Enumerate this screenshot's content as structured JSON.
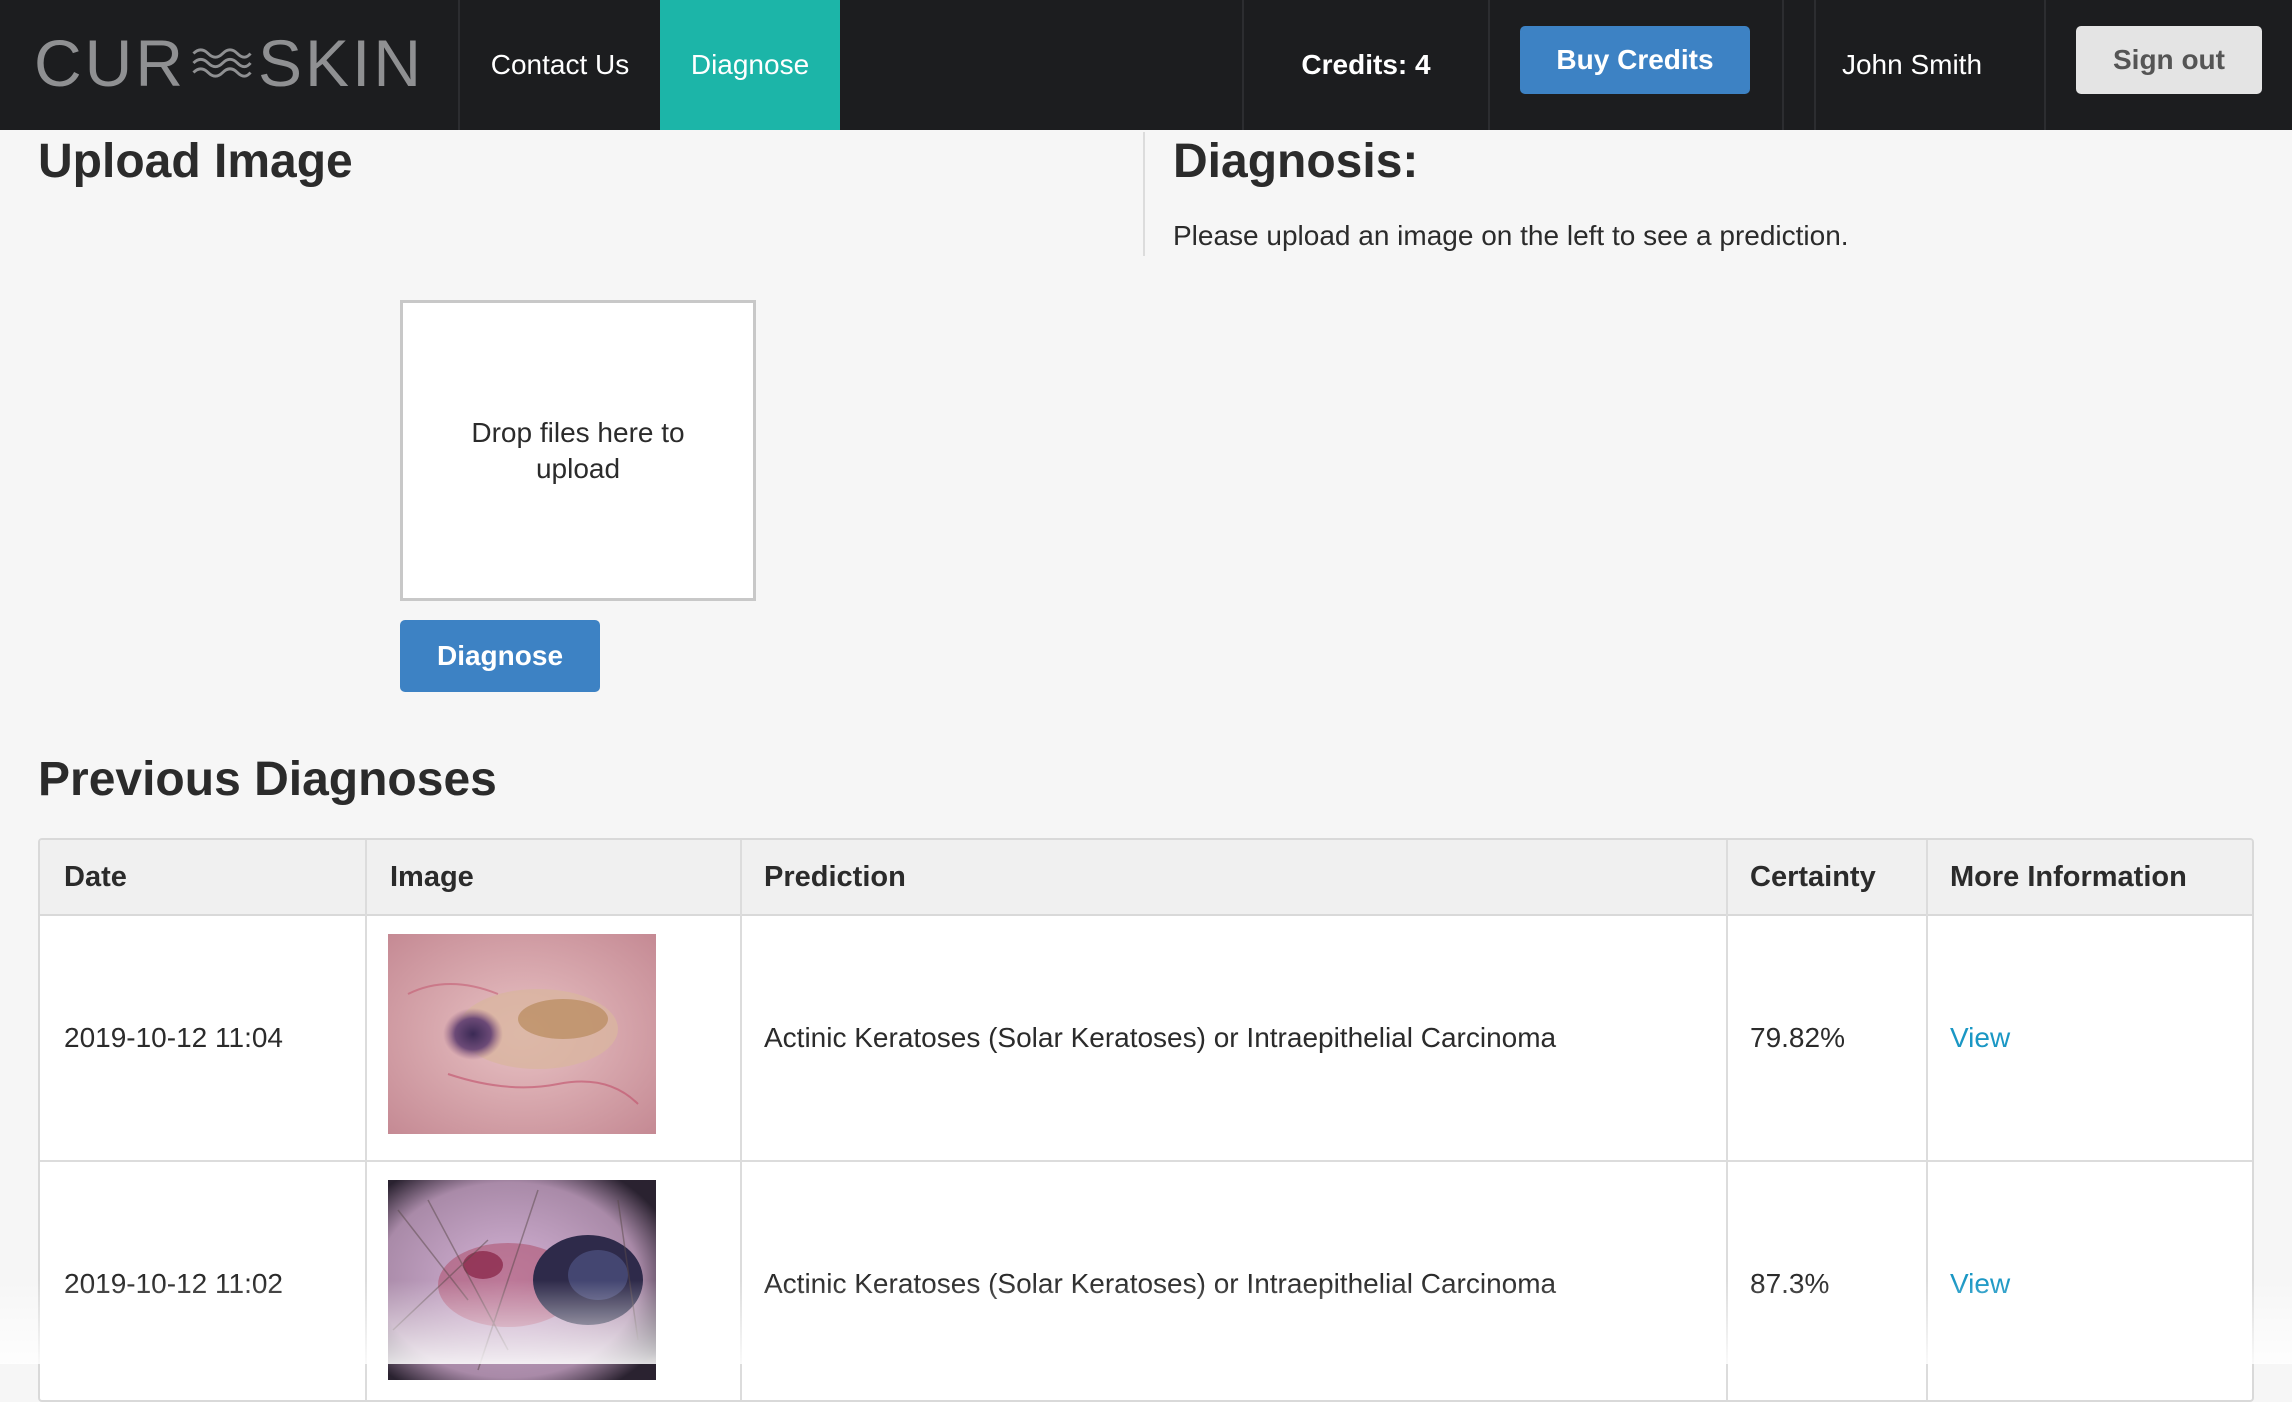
{
  "brand": {
    "left": "CUR",
    "right": "SKIN"
  },
  "nav": {
    "contact_label": "Contact Us",
    "diagnose_label": "Diagnose",
    "credits_label": "Credits: 4",
    "buy_credits_label": "Buy Credits",
    "user_name": "John Smith",
    "sign_out_label": "Sign out"
  },
  "upload": {
    "title": "Upload Image",
    "dropzone_text": "Drop files here to upload",
    "diagnose_button": "Diagnose"
  },
  "diagnosis": {
    "title": "Diagnosis:",
    "message": "Please upload an image on the left to see a prediction."
  },
  "previous": {
    "title": "Previous Diagnoses",
    "columns": [
      "Date",
      "Image",
      "Prediction",
      "Certainty",
      "More Information"
    ],
    "rows": [
      {
        "date": "2019-10-12 11:04",
        "prediction": "Actinic Keratoses (Solar Keratoses) or Intraepithelial Carcinoma",
        "certainty": "79.82%",
        "link": "View"
      },
      {
        "date": "2019-10-12 11:02",
        "prediction": "Actinic Keratoses (Solar Keratoses) or Intraepithelial Carcinoma",
        "certainty": "87.3%",
        "link": "View"
      }
    ]
  },
  "colors": {
    "navbar": "#1c1d1f",
    "active_tab": "#1cb5a8",
    "primary_button": "#3d82c4",
    "link": "#1a97c4"
  }
}
